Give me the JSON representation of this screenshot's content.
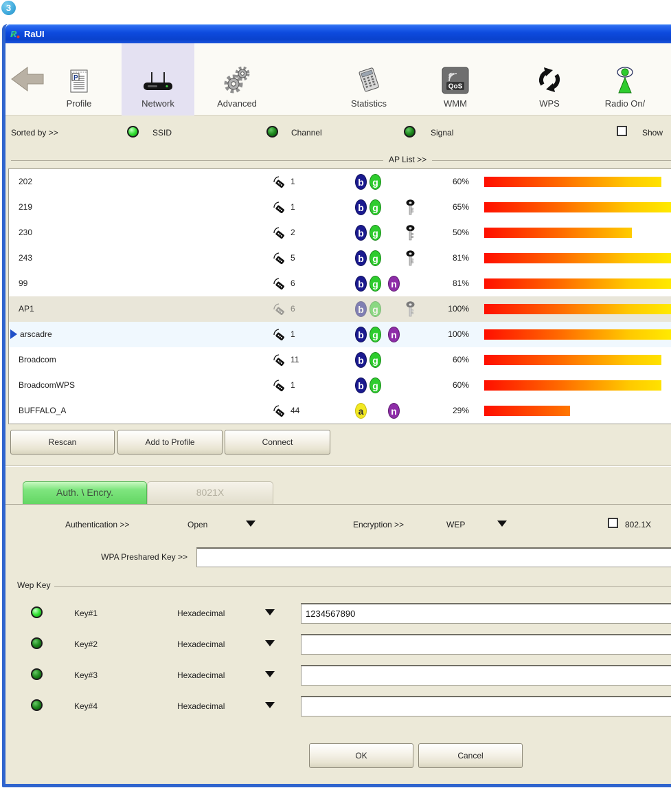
{
  "annotation_badge": {
    "label": "3"
  },
  "window": {
    "title": "RaUI"
  },
  "toolbar": {
    "items": [
      {
        "label": "Profile"
      },
      {
        "label": "Network",
        "active": true
      },
      {
        "label": "Advanced"
      },
      {
        "label": "Statistics"
      },
      {
        "label": "WMM"
      },
      {
        "label": "WPS"
      },
      {
        "label": "Radio On/"
      }
    ]
  },
  "sort_bar": {
    "label": "Sorted by >>",
    "options": [
      {
        "label": "SSID",
        "selected": true
      },
      {
        "label": "Channel",
        "selected": false
      },
      {
        "label": "Signal",
        "selected": false
      }
    ],
    "show_label": "Show"
  },
  "ap_list": {
    "group_label": "AP List >>",
    "rows": [
      {
        "ssid": "202",
        "channel": "1",
        "standards": [
          "b",
          "g"
        ],
        "secured": false,
        "signal": "60%",
        "signal_pct": 60
      },
      {
        "ssid": "219",
        "channel": "1",
        "standards": [
          "b",
          "g"
        ],
        "secured": true,
        "signal": "65%",
        "signal_pct": 65
      },
      {
        "ssid": "230",
        "channel": "2",
        "standards": [
          "b",
          "g"
        ],
        "secured": true,
        "signal": "50%",
        "signal_pct": 50
      },
      {
        "ssid": "243",
        "channel": "5",
        "standards": [
          "b",
          "g"
        ],
        "secured": true,
        "signal": "81%",
        "signal_pct": 81
      },
      {
        "ssid": "99",
        "channel": "6",
        "standards": [
          "b",
          "g",
          "n"
        ],
        "secured": false,
        "signal": "81%",
        "signal_pct": 81
      },
      {
        "ssid": "AP1",
        "channel": "6",
        "standards": [
          "b",
          "g"
        ],
        "secured": true,
        "signal": "100%",
        "signal_pct": 100,
        "dimmed": true
      },
      {
        "ssid": "arscadre",
        "channel": "1",
        "standards": [
          "b",
          "g",
          "n"
        ],
        "secured": false,
        "signal": "100%",
        "signal_pct": 100,
        "selected": true
      },
      {
        "ssid": "Broadcom",
        "channel": "11",
        "standards": [
          "b",
          "g"
        ],
        "secured": false,
        "signal": "60%",
        "signal_pct": 60
      },
      {
        "ssid": "BroadcomWPS",
        "channel": "1",
        "standards": [
          "b",
          "g"
        ],
        "secured": false,
        "signal": "60%",
        "signal_pct": 60
      },
      {
        "ssid": "BUFFALO_A",
        "channel": "44",
        "standards": [
          "a",
          "n"
        ],
        "secured": false,
        "signal": "29%",
        "signal_pct": 29
      }
    ],
    "buttons": [
      {
        "label": "Rescan"
      },
      {
        "label": "Add to Profile"
      },
      {
        "label": "Connect"
      }
    ]
  },
  "tabs": [
    {
      "label": "Auth. \\ Encry.",
      "active": true
    },
    {
      "label": "8021X",
      "active": false
    }
  ],
  "auth_section": {
    "authentication_label": "Authentication >>",
    "authentication_value": "Open",
    "encryption_label": "Encryption >>",
    "encryption_value": "WEP",
    "dot1x_label": "802.1X",
    "wpa_key_label": "WPA Preshared Key >>",
    "wpa_key_value": ""
  },
  "wep_section": {
    "group_label": "Wep Key",
    "keys": [
      {
        "label": "Key#1",
        "format": "Hexadecimal",
        "value": "1234567890",
        "selected": true
      },
      {
        "label": "Key#2",
        "format": "Hexadecimal",
        "value": "",
        "selected": false
      },
      {
        "label": "Key#3",
        "format": "Hexadecimal",
        "value": "",
        "selected": false
      },
      {
        "label": "Key#4",
        "format": "Hexadecimal",
        "value": "",
        "selected": false
      }
    ]
  },
  "footer": {
    "ok_label": "OK",
    "cancel_label": "Cancel"
  },
  "colors": {
    "title_blue": "#0d4ade",
    "window_border": "#2f64ce",
    "client_bg": "#ece9d8",
    "tab_active_green": "#7fe57f",
    "radio_on_green": "#35e035",
    "badge_b": "#1a1a8f",
    "badge_g": "#2ecc2e",
    "badge_n": "#8e2da8",
    "badge_a": "#f2e822",
    "bar_gradient_start": "#ff0f00",
    "bar_gradient_end": "#fff600"
  }
}
